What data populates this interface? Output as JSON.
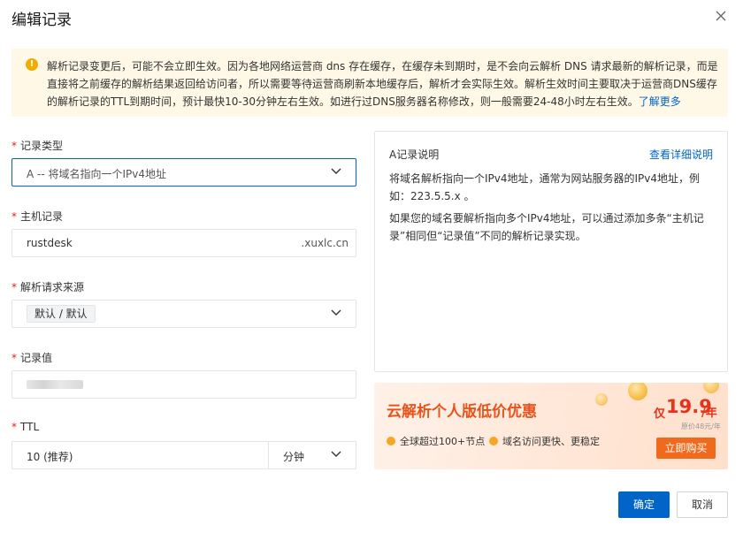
{
  "dialog": {
    "title": "编辑记录",
    "close_icon": "close-icon"
  },
  "notice": {
    "icon": "warning-icon",
    "icon_glyph": "!",
    "text": "解析记录变更后，可能不会立即生效。因为各地网络运营商 dns 存在缓存，在缓存未到期时，是不会向云解析 DNS 请求最新的解析记录，而是直接将之前缓存的解析结果返回给访问者，所以需要等待运营商刷新本地缓存后，解析才会实际生效。解析生效时间主要取决于运营商DNS缓存的解析记录的TTL到期时间，预计最快10-30分钟左右生效。如进行过DNS服务器名称修改，则一般需要24-48小时左右生效。",
    "learn_more": "了解更多"
  },
  "form": {
    "required_mark": "*",
    "record_type": {
      "label": "记录类型",
      "value": "A -- 将域名指向一个IPv4地址"
    },
    "host": {
      "label": "主机记录",
      "value": "rustdesk",
      "suffix": ".xuxlc.cn"
    },
    "source": {
      "label": "解析请求来源",
      "value": "默认 / 默认"
    },
    "record_value": {
      "label": "记录值"
    },
    "ttl": {
      "label": "TTL",
      "value": "10 (推荐)",
      "unit": "分钟"
    }
  },
  "info_panel": {
    "title": "A记录说明",
    "link": "查看详细说明",
    "p1": "将域名解析指向一个IPv4地址，通常为网站服务器的IPv4地址，例如：223.5.5.x 。",
    "p2": "如果您的域名要解析指向多个IPv4地址，可以通过添加多条“主机记录”相同但“记录值”不同的解析记录实现。"
  },
  "promo": {
    "title": "云解析个人版低价优惠",
    "price_prefix": "仅",
    "price": "19.9",
    "price_unit": "/年",
    "original_price": "原价48元/年",
    "feature1": "全球超过100+节点",
    "feature2": "域名访问更快、更稳定",
    "buy_label": "立即购买"
  },
  "footer": {
    "ok_label": "确定",
    "cancel_label": "取消"
  },
  "colors": {
    "primary": "#0064c8",
    "required": "#e2231a",
    "warning": "#f0ad00",
    "promo_accent": "#e8531c",
    "promo_price": "#e8321c"
  }
}
